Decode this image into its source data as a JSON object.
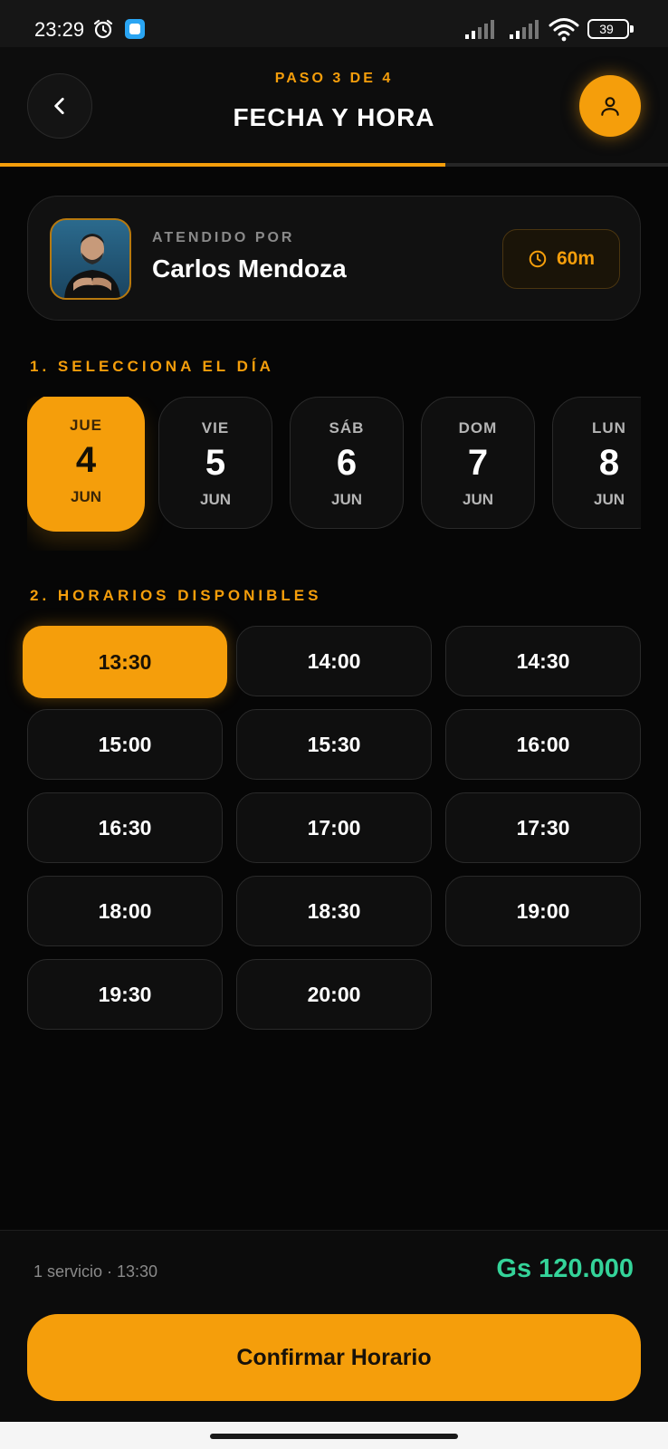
{
  "status_bar": {
    "time": "23:29",
    "battery": "39"
  },
  "header": {
    "step": "PASO 3 DE 4",
    "title": "FECHA Y HORA",
    "progress": 0.667
  },
  "barber": {
    "attended_label": "ATENDIDO POR",
    "name": "Carlos Mendoza",
    "duration": "60m"
  },
  "days_section": {
    "title": "1. SELECCIONA EL DÍA",
    "selected_index": 0,
    "days": [
      {
        "dow": "JUE",
        "num": "4",
        "month": "JUN"
      },
      {
        "dow": "VIE",
        "num": "5",
        "month": "JUN"
      },
      {
        "dow": "SÁB",
        "num": "6",
        "month": "JUN"
      },
      {
        "dow": "DOM",
        "num": "7",
        "month": "JUN"
      },
      {
        "dow": "LUN",
        "num": "8",
        "month": "JUN"
      }
    ]
  },
  "slots_section": {
    "title": "2. HORARIOS DISPONIBLES",
    "selected_index": 0,
    "slots": [
      "13:30",
      "14:00",
      "14:30",
      "15:00",
      "15:30",
      "16:00",
      "16:30",
      "17:00",
      "17:30",
      "18:00",
      "18:30",
      "19:00",
      "19:30",
      "20:00"
    ]
  },
  "footer": {
    "summary": "1 servicio · 13:30",
    "total": "Gs 120.000",
    "confirm_label": "Confirmar Horario"
  },
  "colors": {
    "accent": "#f59e0b",
    "price": "#34d399",
    "background": "#060606"
  },
  "icons": [
    "alarm-icon",
    "app-notification-icon",
    "signal-icon",
    "wifi-icon",
    "battery-icon",
    "chevron-left-icon",
    "user-icon",
    "clock-icon"
  ]
}
